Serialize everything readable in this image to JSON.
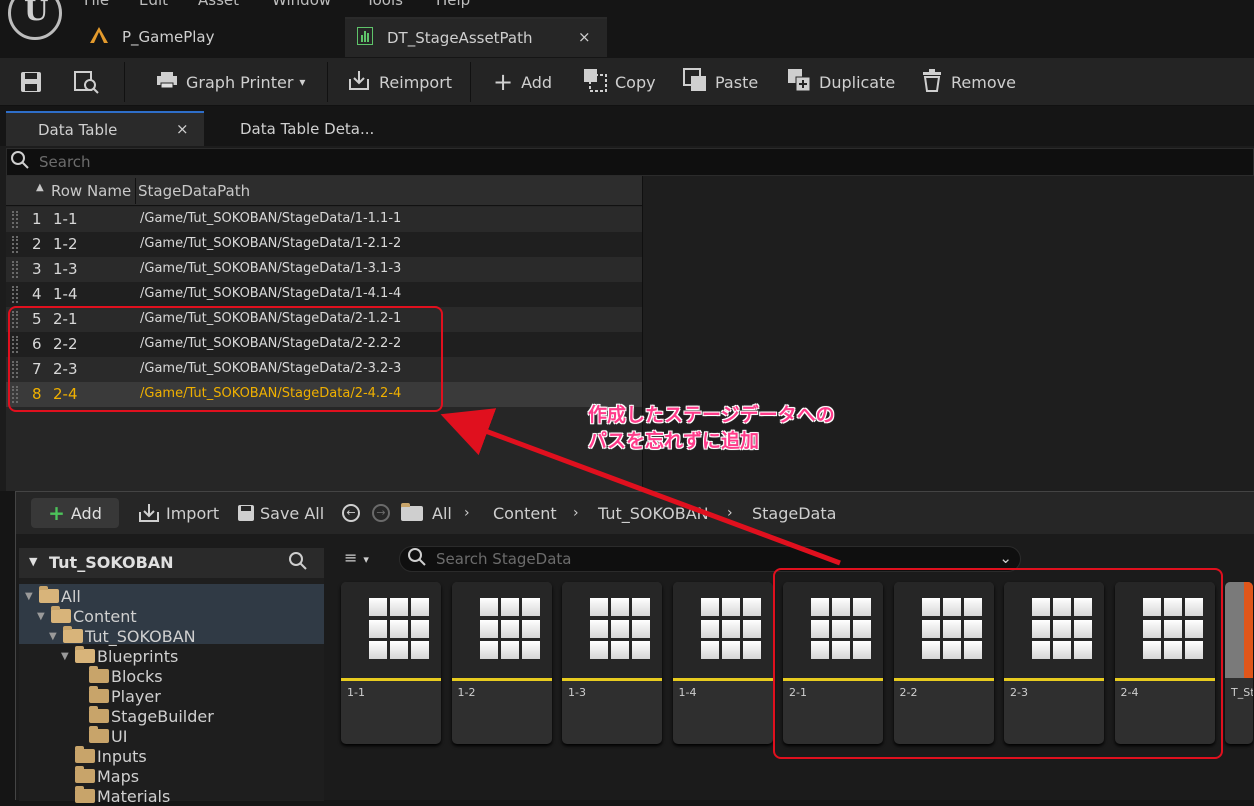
{
  "menu": [
    "File",
    "Edit",
    "Asset",
    "Window",
    "Tools",
    "Help"
  ],
  "tabs": [
    {
      "label": "P_GamePlay"
    },
    {
      "label": "DT_StageAssetPath",
      "close": "×"
    }
  ],
  "toolbar": {
    "graph_printer": "Graph Printer",
    "reimport": "Reimport",
    "add": "Add",
    "copy": "Copy",
    "paste": "Paste",
    "duplicate": "Duplicate",
    "remove": "Remove"
  },
  "panel_tabs": [
    {
      "label": "Data Table",
      "close": "×"
    },
    {
      "label": "Data Table Deta..."
    }
  ],
  "search_placeholder": "Search",
  "table": {
    "headers": [
      "Row Name",
      "StageDataPath"
    ],
    "rows": [
      {
        "index": "1",
        "name": "1-1",
        "path": "/Game/Tut_SOKOBAN/StageData/1-1.1-1"
      },
      {
        "index": "2",
        "name": "1-2",
        "path": "/Game/Tut_SOKOBAN/StageData/1-2.1-2"
      },
      {
        "index": "3",
        "name": "1-3",
        "path": "/Game/Tut_SOKOBAN/StageData/1-3.1-3"
      },
      {
        "index": "4",
        "name": "1-4",
        "path": "/Game/Tut_SOKOBAN/StageData/1-4.1-4"
      },
      {
        "index": "5",
        "name": "2-1",
        "path": "/Game/Tut_SOKOBAN/StageData/2-1.2-1"
      },
      {
        "index": "6",
        "name": "2-2",
        "path": "/Game/Tut_SOKOBAN/StageData/2-2.2-2"
      },
      {
        "index": "7",
        "name": "2-3",
        "path": "/Game/Tut_SOKOBAN/StageData/2-3.2-3"
      },
      {
        "index": "8",
        "name": "2-4",
        "path": "/Game/Tut_SOKOBAN/StageData/2-4.2-4"
      }
    ],
    "selected_color": "#f0b000"
  },
  "annotation": {
    "line1": "作成したステージデータへの",
    "line2": "パスを忘れずに追加",
    "color": "#ff3b8a",
    "highlight_color": "#e0101e"
  },
  "content_browser": {
    "add": "Add",
    "import": "Import",
    "save_all": "Save All",
    "breadcrumb": [
      "All",
      "Content",
      "Tut_SOKOBAN",
      "StageData"
    ],
    "tree_title": "Tut_SOKOBAN",
    "tree": [
      {
        "label": "All"
      },
      {
        "label": "Content"
      },
      {
        "label": "Tut_SOKOBAN"
      },
      {
        "label": "Blueprints"
      },
      {
        "label": "Blocks"
      },
      {
        "label": "Player"
      },
      {
        "label": "StageBuilder"
      },
      {
        "label": "UI"
      },
      {
        "label": "Inputs"
      },
      {
        "label": "Maps"
      },
      {
        "label": "Materials"
      }
    ],
    "search_placeholder": "Search StageData",
    "assets": [
      "1-1",
      "1-2",
      "1-3",
      "1-4",
      "2-1",
      "2-2",
      "2-3",
      "2-4",
      "T_St"
    ]
  }
}
